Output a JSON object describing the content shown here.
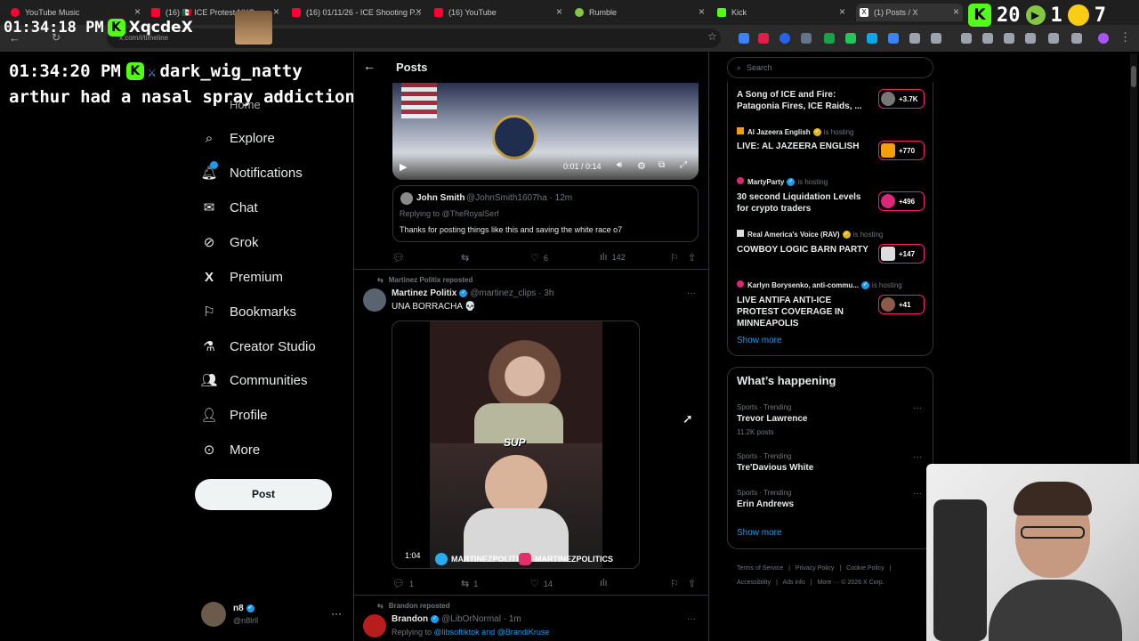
{
  "browser": {
    "tabs": [
      {
        "label": "YouTube Music",
        "color": "#ff0033"
      },
      {
        "label": "(16) 🇲🇽 ICE Protest NYC",
        "color": "#ff0033"
      },
      {
        "label": "(16) 01/11/26 - ICE Shooting P...",
        "color": "#ff0033"
      },
      {
        "label": "(16) YouTube",
        "color": "#ff0033"
      },
      {
        "label": "Rumble",
        "color": "#85c742"
      },
      {
        "label": "Kick",
        "color": "#53fc18"
      },
      {
        "label": "(1) Posts / X",
        "color": "#ffffff"
      }
    ],
    "url": "x.com/i/timeline"
  },
  "overlay": {
    "clock1": "01:34:18 PM",
    "user1": "XqcdeX",
    "clock2": "01:34:20 PM",
    "user2": "dark_wig_natty",
    "message": "arthur had a nasal spray addiction",
    "counter_a": "20",
    "counter_b": "1",
    "counter_c": "7"
  },
  "nav": {
    "home": "Home",
    "items": [
      {
        "label": "Explore",
        "icon": "search-icon"
      },
      {
        "label": "Notifications",
        "icon": "bell-icon"
      },
      {
        "label": "Chat",
        "icon": "mail-icon"
      },
      {
        "label": "Grok",
        "icon": "grok-icon"
      },
      {
        "label": "Premium",
        "icon": "x-logo-icon"
      },
      {
        "label": "Bookmarks",
        "icon": "bookmark-icon"
      },
      {
        "label": "Creator Studio",
        "icon": "flask-icon"
      },
      {
        "label": "Communities",
        "icon": "people-icon"
      },
      {
        "label": "Profile",
        "icon": "person-icon"
      },
      {
        "label": "More",
        "icon": "more-icon"
      }
    ],
    "post_button": "Post",
    "account_name": "n8",
    "account_handle": "@n8lrll"
  },
  "header": {
    "title": "Posts"
  },
  "post1": {
    "video_time": "0:01 / 0:14",
    "quote_name": "John Smith",
    "quote_handle": "@JohnSmith1607ha · 12m",
    "quote_reply_to": "Replying to @TheRoyalSerf",
    "quote_text": "Thanks for posting things like this and saving the white race o7",
    "likes": "6",
    "views": "142"
  },
  "post2": {
    "repost_label": "Martinez Politix reposted",
    "name": "Martinez Politix",
    "handle": "@martinez_clips · 3h",
    "text": "UNA BORRACHA 💀",
    "video_duration": "1:04",
    "sup_text": "SUP",
    "watermark": "MARTINEZPOLITIX",
    "watermark2": "MARTINEZPOLITICS",
    "replies": "1",
    "reposts": "1",
    "likes": "14"
  },
  "post3": {
    "repost_label": "Brandon reposted",
    "name": "Brandon",
    "handle": "@LibOrNormal · 1m",
    "reply_prefix": "Replying to ",
    "reply_to": "@libsoftiktok and @BrandiKruse"
  },
  "search": {
    "placeholder": "Search"
  },
  "live": [
    {
      "host": "",
      "hosting": "",
      "title": "A Song of ICE and Fire: Patagonia Fires, ICE Raids, ...",
      "count": "+3.7K"
    },
    {
      "host": "Al Jazeera English",
      "hosting": "is hosting",
      "title": "LIVE: AL JAZEERA ENGLISH",
      "count": "+770"
    },
    {
      "host": "MartyParty",
      "hosting": "is hosting",
      "title": "30 second Liquidation Levels for crypto traders",
      "count": "+496"
    },
    {
      "host": "Real America's Voice (RAV)",
      "hosting": "is hosting",
      "title": "COWBOY LOGIC BARN PARTY",
      "count": "+147"
    },
    {
      "host": "Karlyn Borysenko, anti-commu...",
      "hosting": "is hosting",
      "title": "LIVE ANTIFA ANTI-ICE PROTEST COVERAGE IN MINNEAPOLIS",
      "count": "+41"
    }
  ],
  "live_show_more": "Show more",
  "happening": {
    "title": "What’s happening",
    "trends": [
      {
        "category": "Sports · Trending",
        "name": "Trevor Lawrence",
        "posts": "11.2K posts"
      },
      {
        "category": "Sports · Trending",
        "name": "Tre'Davious White",
        "posts": ""
      },
      {
        "category": "Sports · Trending",
        "name": "Erin Andrews",
        "posts": ""
      }
    ],
    "show_more": "Show more"
  },
  "footer": {
    "line1": [
      "Terms of Service",
      "Privacy Policy",
      "Cookie Policy"
    ],
    "accessibility": "Accessibility",
    "ads": "Ads info",
    "more": "More ···",
    "copyright": "© 2026 X Corp."
  }
}
